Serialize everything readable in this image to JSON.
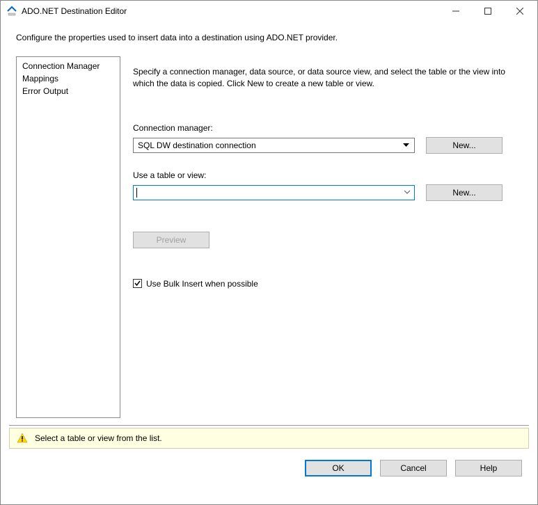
{
  "window": {
    "title": "ADO.NET Destination Editor"
  },
  "description": "Configure the properties used to insert data into a destination using ADO.NET provider.",
  "sidebar": {
    "items": [
      {
        "label": "Connection Manager"
      },
      {
        "label": "Mappings"
      },
      {
        "label": "Error Output"
      }
    ],
    "selected": 0
  },
  "main": {
    "instruction": "Specify a connection manager, data source, or data source view, and select the table or the view into which the data is copied. Click New to create a new table or view.",
    "connection_manager_label": "Connection manager:",
    "connection_manager_value": "SQL DW destination connection",
    "new_button_1": "New...",
    "table_view_label": "Use a table or view:",
    "table_view_value": "",
    "new_button_2": "New...",
    "preview_button": "Preview",
    "bulk_insert_checked": true,
    "bulk_insert_label": "Use Bulk Insert when possible"
  },
  "status": {
    "message": "Select a table or view from the list."
  },
  "buttons": {
    "ok": "OK",
    "cancel": "Cancel",
    "help": "Help"
  }
}
